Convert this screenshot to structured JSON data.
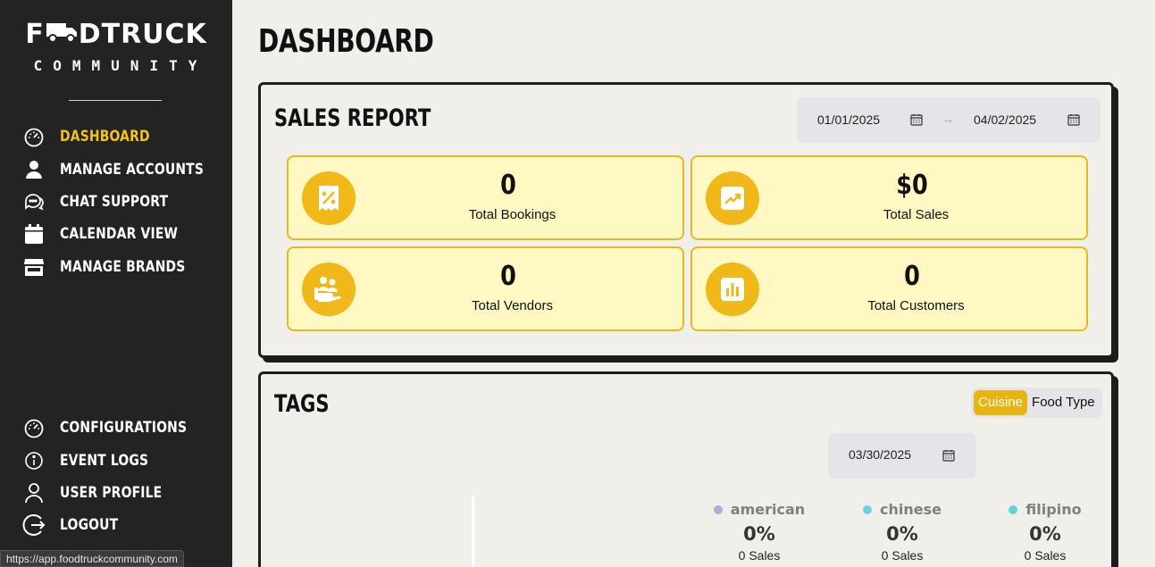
{
  "brand": {
    "logo_top": "FOODTRUCK",
    "logo_left": "F",
    "logo_right": "DTRUCK",
    "logo_bottom": "COMMUNITY"
  },
  "sidebar": {
    "top_items": [
      {
        "label": "DASHBOARD",
        "icon": "speedometer-icon",
        "active": true
      },
      {
        "label": "MANAGE ACCOUNTS",
        "icon": "user-icon"
      },
      {
        "label": "CHAT SUPPORT",
        "icon": "chat-bubbles-icon"
      },
      {
        "label": "CALENDAR VIEW",
        "icon": "calendar-icon"
      },
      {
        "label": "MANAGE BRANDS",
        "icon": "storefront-icon"
      }
    ],
    "bottom_items": [
      {
        "label": "CONFIGURATIONS",
        "icon": "speedometer-icon"
      },
      {
        "label": "EVENT LOGS",
        "icon": "info-icon"
      },
      {
        "label": "USER PROFILE",
        "icon": "user-outline-icon"
      },
      {
        "label": "LOGOUT",
        "icon": "logout-icon"
      }
    ]
  },
  "status_bar_url": "https://app.foodtruckcommunity.com",
  "page": {
    "title": "DASHBOARD"
  },
  "sales_report": {
    "title": "SALES REPORT",
    "start_date": "01/01/2025",
    "end_date": "04/02/2025",
    "arrow": "→",
    "stats": [
      {
        "value": "0",
        "label": "Total Bookings",
        "icon": "discount-receipt-icon"
      },
      {
        "value": "$0",
        "label": "Total Sales",
        "icon": "trend-up-icon"
      },
      {
        "value": "0",
        "label": "Total Vendors",
        "icon": "hand-people-icon"
      },
      {
        "value": "0",
        "label": "Total Customers",
        "icon": "bar-chart-icon"
      }
    ]
  },
  "tags": {
    "title": "TAGS",
    "toggle": {
      "options": [
        "Cuisine",
        "Food Type"
      ],
      "selected": "Cuisine"
    },
    "date": "03/30/2025",
    "items": [
      {
        "name": "american",
        "percent": "0%",
        "sales": "0 Sales",
        "color": "#b3a9d9"
      },
      {
        "name": "chinese",
        "percent": "0%",
        "sales": "0 Sales",
        "color": "#6fcfe0"
      },
      {
        "name": "filipino",
        "percent": "0%",
        "sales": "0 Sales",
        "color": "#5fd3d8"
      }
    ]
  },
  "colors": {
    "accent": "#f5c21b",
    "sidebar_bg": "#232323",
    "stat_bg": "#fff8c2",
    "stat_border": "#e8b81f"
  }
}
